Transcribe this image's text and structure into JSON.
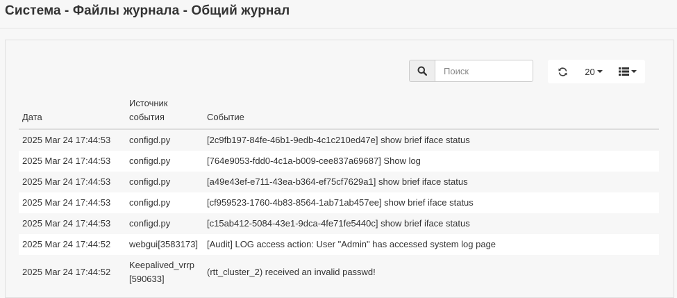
{
  "header": {
    "title": "Система - Файлы журнала - Общий журнал"
  },
  "toolbar": {
    "search_placeholder": "Поиск",
    "search_icon": "search-icon",
    "refresh_icon": "refresh-icon",
    "rows_per_page": "20",
    "columns_icon": "list-columns-icon"
  },
  "table": {
    "columns": {
      "date": "Дата",
      "source": "Источник события",
      "event": "Событие"
    },
    "rows": [
      {
        "date": "2025 Mar 24 17:44:53",
        "source": "configd.py",
        "event": "[2c9fb197-84fe-46b1-9edb-4c1c210ed47e] show brief iface status"
      },
      {
        "date": "2025 Mar 24 17:44:53",
        "source": "configd.py",
        "event": "[764e9053-fdd0-4c1a-b009-cee837a69687] Show log"
      },
      {
        "date": "2025 Mar 24 17:44:53",
        "source": "configd.py",
        "event": "[a49e43ef-e711-43ea-b364-ef75cf7629a1] show brief iface status"
      },
      {
        "date": "2025 Mar 24 17:44:53",
        "source": "configd.py",
        "event": "[cf959523-1760-4b83-8564-1ab71ab457ee] show brief iface status"
      },
      {
        "date": "2025 Mar 24 17:44:53",
        "source": "configd.py",
        "event": "[c15ab412-5084-43e1-9dca-4fe71fe5440c] show brief iface status"
      },
      {
        "date": "2025 Mar 24 17:44:52",
        "source": "webgui[3583173]",
        "event": "[Audit] LOG access action: User \"Admin\" has accessed system log page"
      },
      {
        "date": "2025 Mar 24 17:44:52",
        "source": "Keepalived_vrrp[590633]",
        "event": "(rtt_cluster_2) received an invalid passwd!"
      }
    ]
  }
}
